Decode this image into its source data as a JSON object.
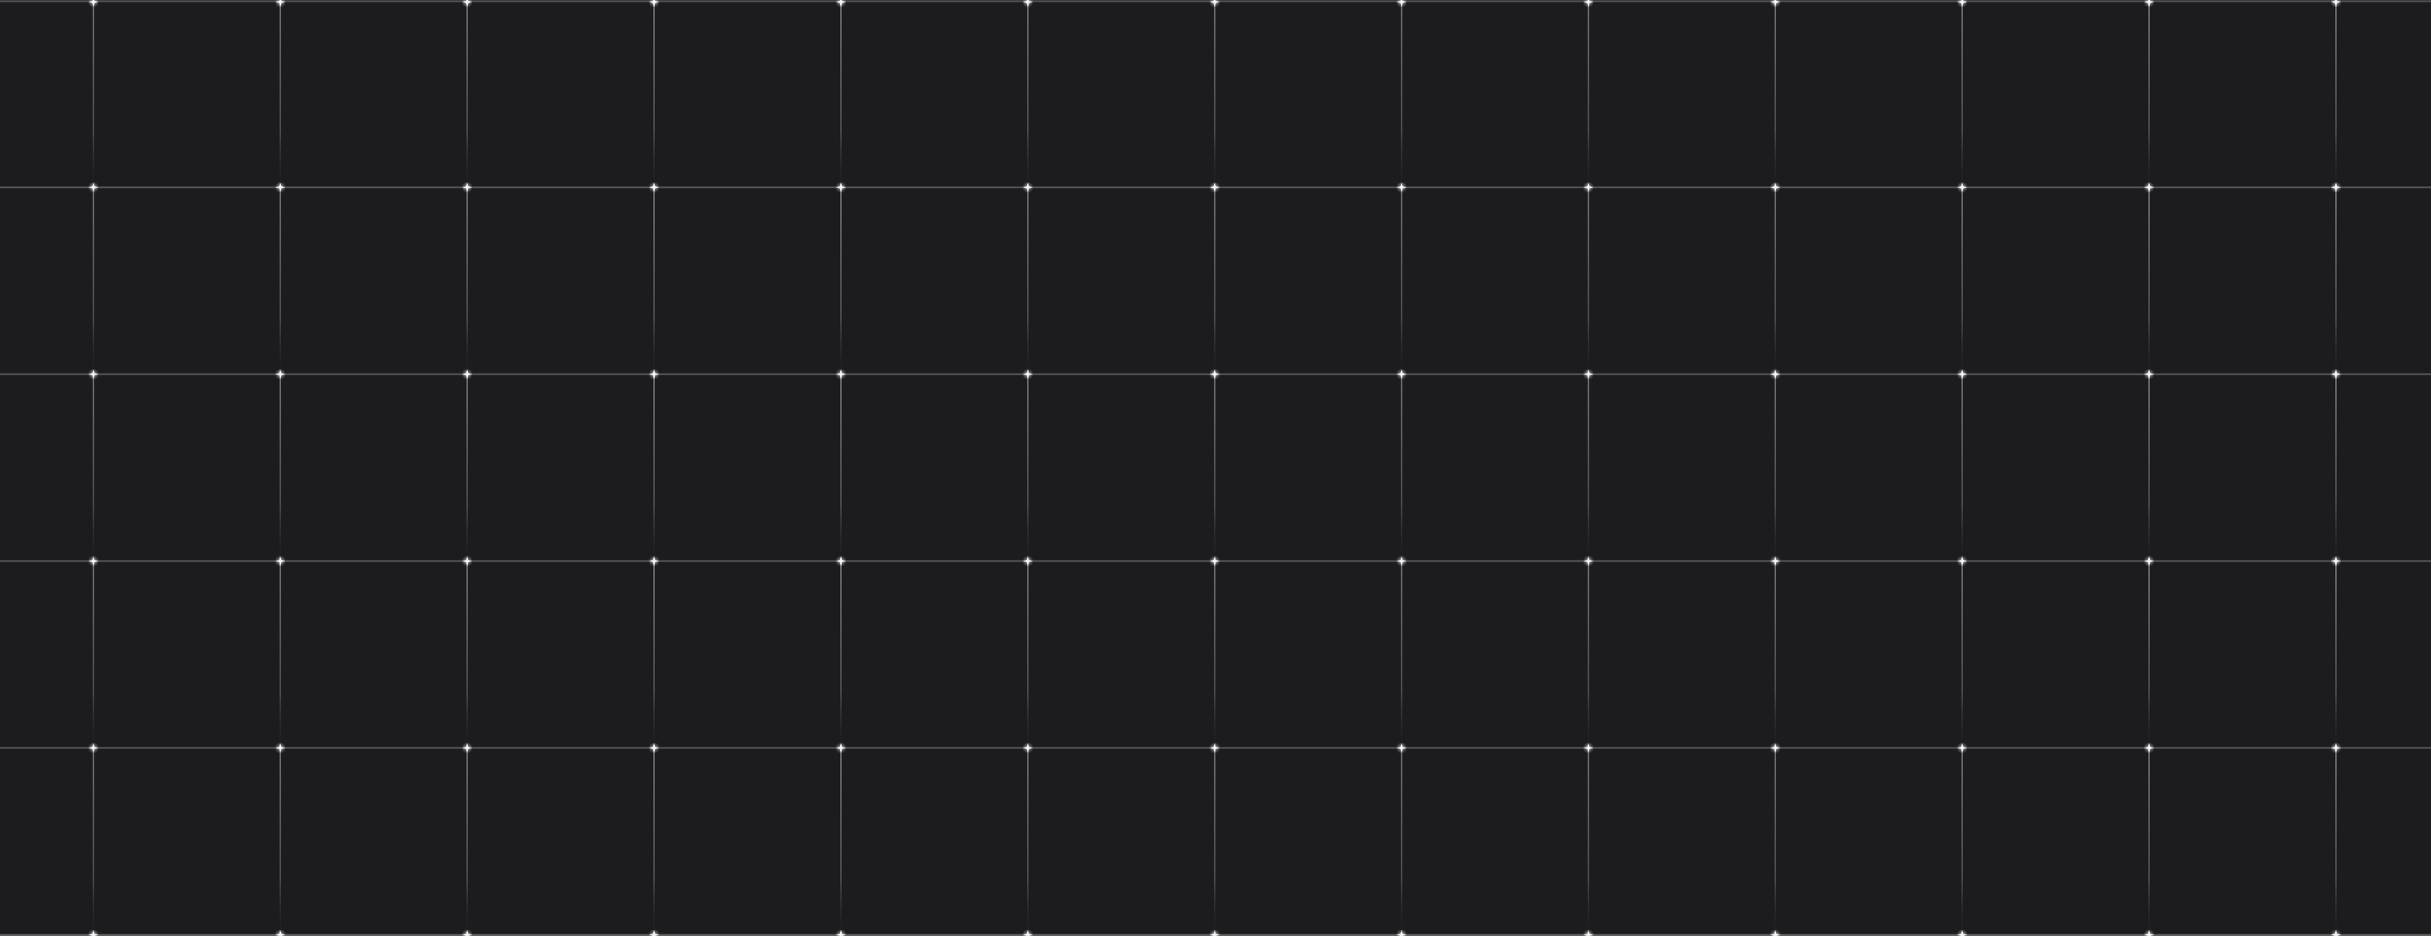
{
  "background": {
    "color": "#1c1c1e",
    "line_color": "#6e6e73",
    "line_fade_color": "#1c1c1e",
    "node_color": "#f2f2f7",
    "node_glow_color": "#ffffff"
  },
  "grid": {
    "columns": 13,
    "rows": 5,
    "node-icon": "sparkle-icon"
  }
}
